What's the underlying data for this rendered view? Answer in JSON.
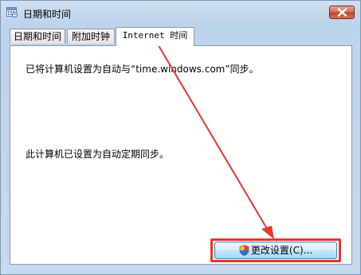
{
  "window": {
    "title": "日期和时间",
    "icons": {
      "app": "calendar-clock-icon",
      "close": "close-icon"
    }
  },
  "tabs": [
    {
      "label": "日期和时间",
      "active": false
    },
    {
      "label": "附加时钟",
      "active": false
    },
    {
      "label": "Internet 时间",
      "active": true
    }
  ],
  "content": {
    "sync_status": "已将计算机设置为自动与“time.windows.com”同步。",
    "schedule_status": "此计算机已设置为自动定期同步。"
  },
  "buttons": {
    "change_settings": "更改设置(C)...",
    "change_settings_icon": "uac-shield-icon"
  },
  "annotation": {
    "color": "#e8352d",
    "type": "red-arrow-and-box"
  }
}
